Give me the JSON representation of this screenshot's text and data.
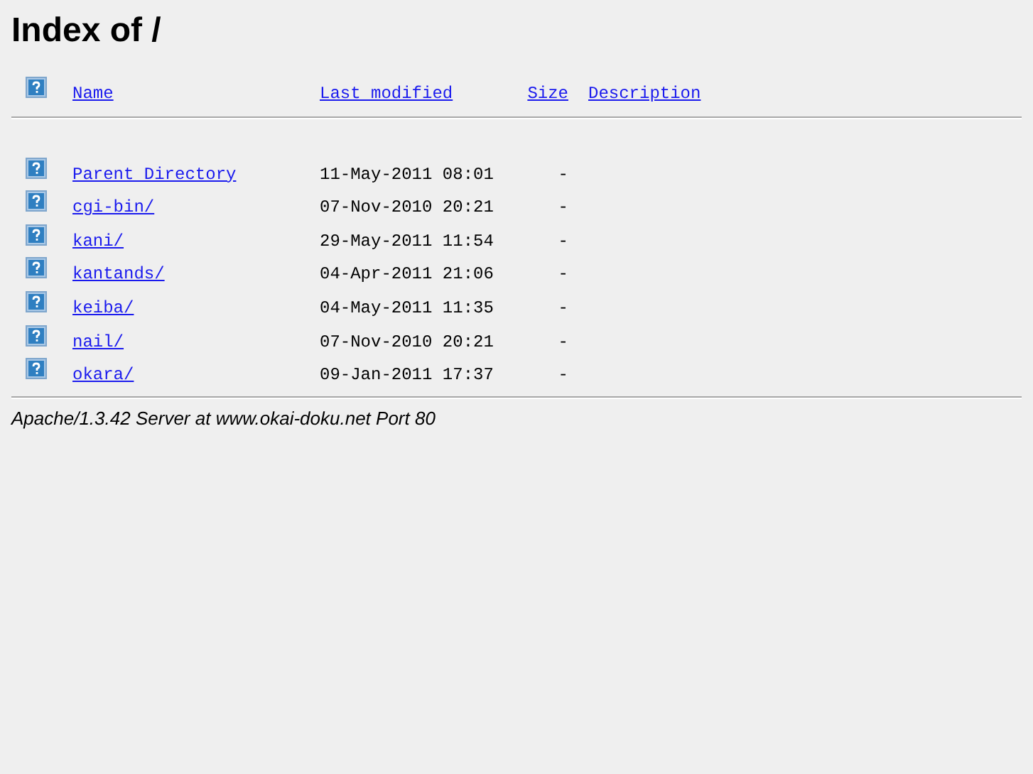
{
  "title": "Index of /",
  "columns": [
    "Name",
    "Last modified",
    "Size",
    "Description"
  ],
  "rows": [
    {
      "name": "Parent Directory",
      "modified": "11-May-2011 08:01",
      "size": "-"
    },
    {
      "name": "cgi-bin/",
      "modified": "07-Nov-2010 20:21",
      "size": "-"
    },
    {
      "name": "kani/",
      "modified": "29-May-2011 11:54",
      "size": "-"
    },
    {
      "name": "kantands/",
      "modified": "04-Apr-2011 21:06",
      "size": "-"
    },
    {
      "name": "keiba/",
      "modified": "04-May-2011 11:35",
      "size": "-"
    },
    {
      "name": "nail/",
      "modified": "07-Nov-2010 20:21",
      "size": "-"
    },
    {
      "name": "okara/",
      "modified": "09-Jan-2011 17:37",
      "size": "-"
    }
  ],
  "footer": "Apache/1.3.42 Server at www.okai-doku.net Port 80"
}
